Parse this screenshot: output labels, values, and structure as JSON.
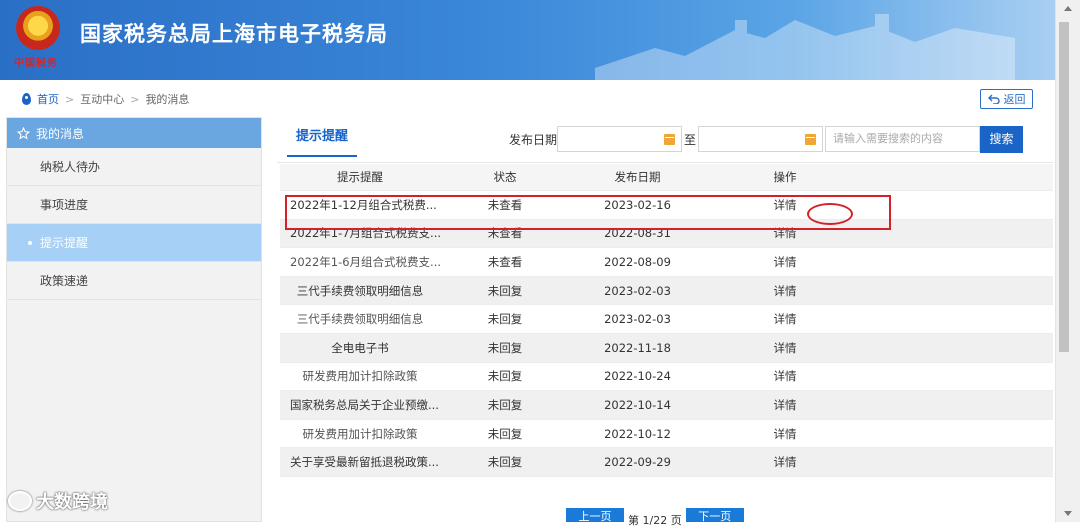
{
  "header": {
    "title": "国家税务总局上海市电子税务局",
    "emblem_text": "中国税务"
  },
  "breadcrumb": {
    "items": [
      "首页",
      "互动中心",
      "我的消息"
    ],
    "separator": ">"
  },
  "back_button": {
    "label": "返回"
  },
  "sidebar": {
    "title": "我的消息",
    "items": [
      {
        "label": "纳税人待办"
      },
      {
        "label": "事项进度"
      },
      {
        "label": "提示提醒",
        "active": true
      },
      {
        "label": "政策速递"
      }
    ]
  },
  "tab": {
    "label": "提示提醒"
  },
  "filter": {
    "date_label": "发布日期",
    "to_label": "至",
    "search_placeholder": "请输入需要搜索的内容",
    "search_button": "搜索"
  },
  "table": {
    "columns": [
      "提示提醒",
      "状态",
      "发布日期",
      "操作"
    ],
    "rows": [
      {
        "title": "2022年1-12月组合式税费...",
        "status": "未查看",
        "date": "2023-02-16",
        "action": "详情"
      },
      {
        "title": "2022年1-7月组合式税费支...",
        "status": "未查看",
        "date": "2022-08-31",
        "action": "详情"
      },
      {
        "title": "2022年1-6月组合式税费支...",
        "status": "未查看",
        "date": "2022-08-09",
        "action": "详情"
      },
      {
        "title": "三代手续费领取明细信息",
        "status": "未回复",
        "date": "2023-02-03",
        "action": "详情"
      },
      {
        "title": "三代手续费领取明细信息",
        "status": "未回复",
        "date": "2023-02-03",
        "action": "详情"
      },
      {
        "title": "全电电子书",
        "status": "未回复",
        "date": "2022-11-18",
        "action": "详情"
      },
      {
        "title": "研发费用加计扣除政策",
        "status": "未回复",
        "date": "2022-10-24",
        "action": "详情"
      },
      {
        "title": "国家税务总局关于企业预缴...",
        "status": "未回复",
        "date": "2022-10-14",
        "action": "详情"
      },
      {
        "title": "研发费用加计扣除政策",
        "status": "未回复",
        "date": "2022-10-12",
        "action": "详情"
      },
      {
        "title": "关于享受最新留抵退税政策...",
        "status": "未回复",
        "date": "2022-09-29",
        "action": "详情"
      }
    ]
  },
  "pager": {
    "prev": "上一页",
    "info": "第 1/22 页",
    "next": "下一页"
  },
  "watermark": {
    "text": "大数跨境"
  },
  "colors": {
    "accent": "#1a64c8",
    "sidebar_active": "#a6d0f6",
    "highlight": "#d42127"
  }
}
